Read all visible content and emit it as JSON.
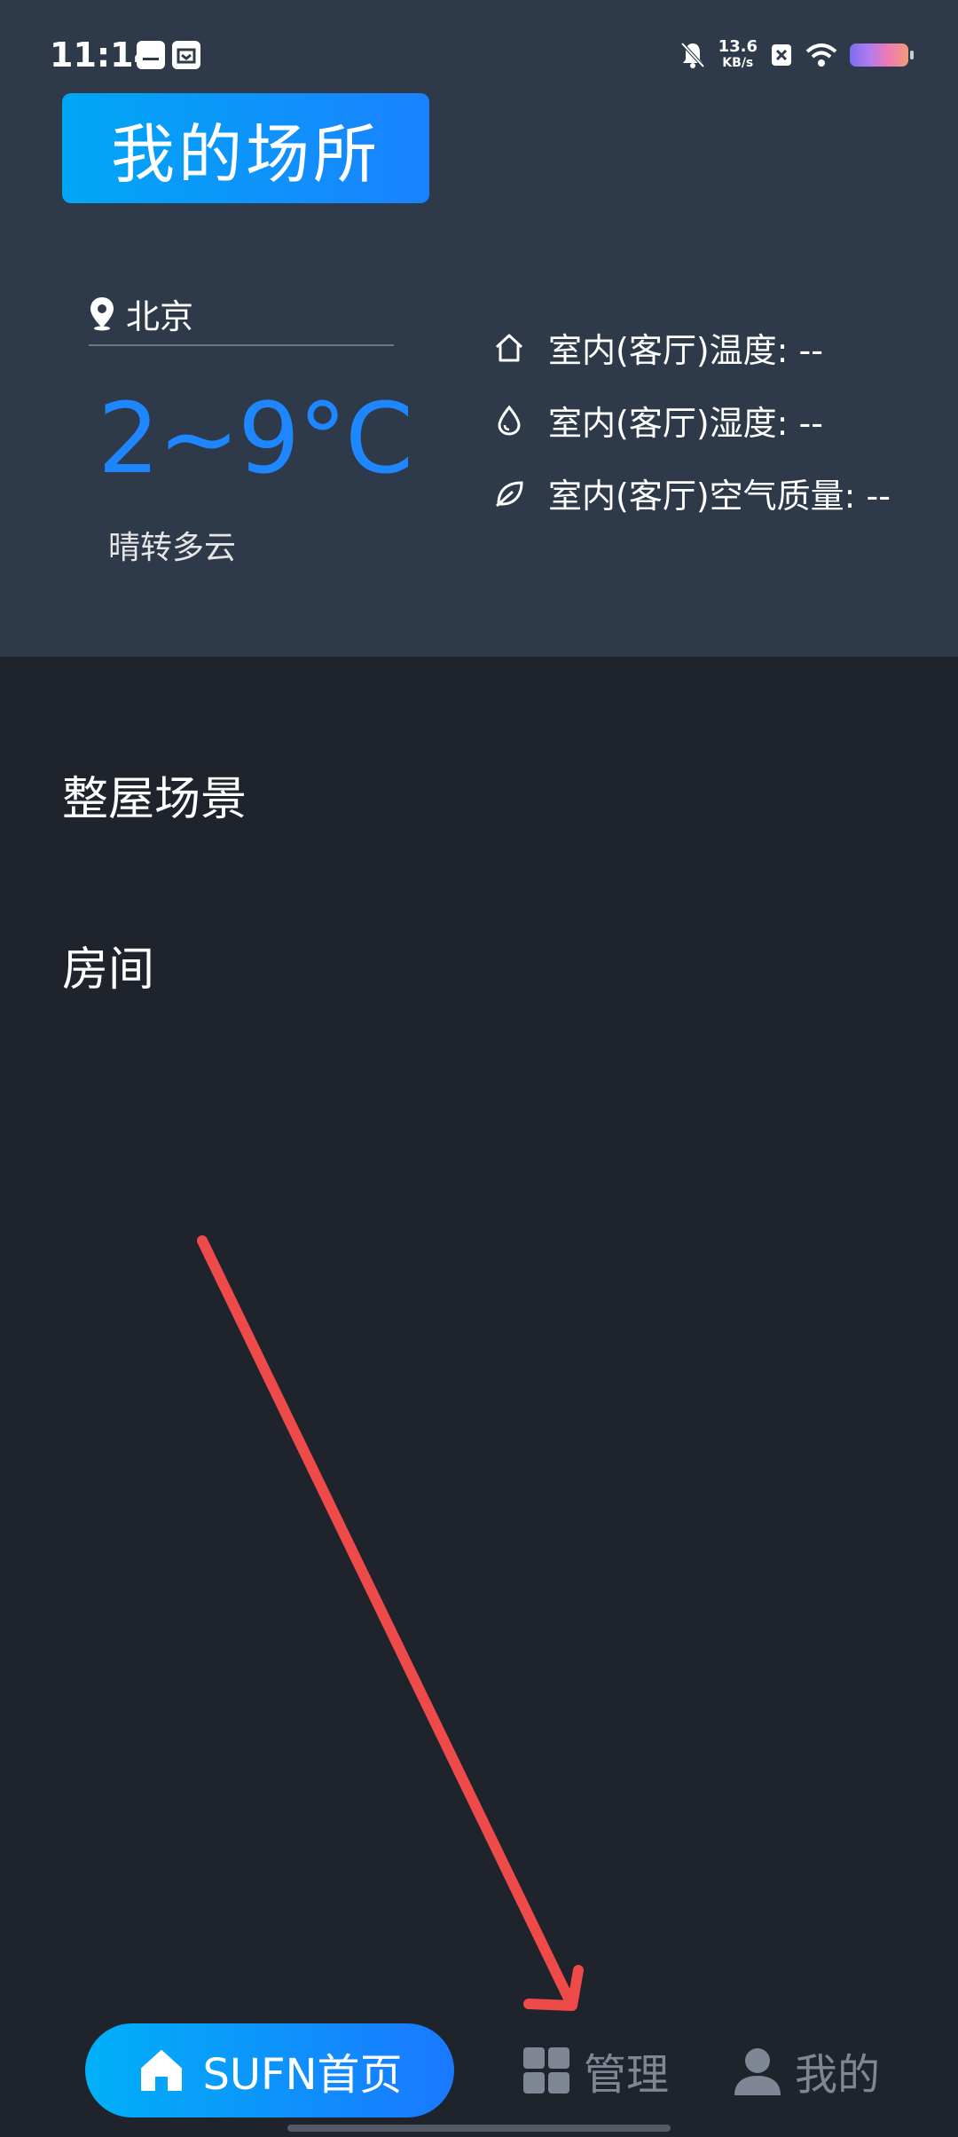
{
  "status_bar": {
    "time": "11:14",
    "net_speed_value": "13.6",
    "net_speed_unit": "KB/s"
  },
  "header": {
    "title": "我的场所"
  },
  "weather": {
    "city": "北京",
    "temperature": "2~9°C",
    "condition": "晴转多云"
  },
  "indoor": [
    {
      "icon": "home-outline-icon",
      "label": "室内(客厅)温度: --"
    },
    {
      "icon": "water-drop-icon",
      "label": "室内(客厅)湿度: --"
    },
    {
      "icon": "leaf-icon",
      "label": "室内(客厅)空气质量: --"
    }
  ],
  "sections": {
    "whole_house_scenes": "整屋场景",
    "rooms": "房间"
  },
  "bottom_nav": {
    "home_label": "SUFN首页",
    "manage_label": "管理",
    "mine_label": "我的"
  },
  "colors": {
    "accent": "#1e86ff",
    "header_bg": "#2e3a4a",
    "body_bg": "#1f232c",
    "annotation_arrow": "#ef4a4a"
  }
}
